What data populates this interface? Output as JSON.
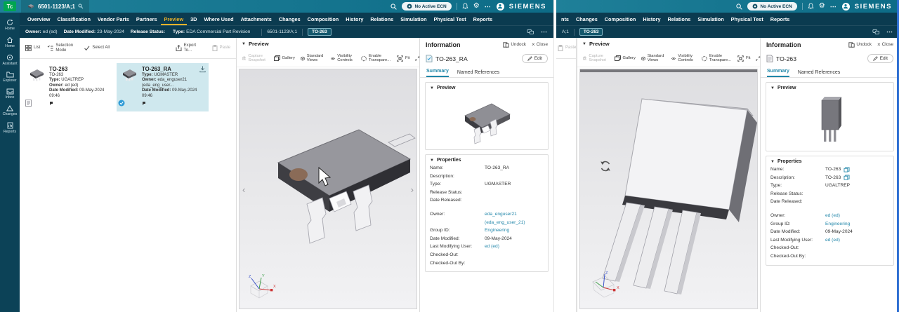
{
  "brand": {
    "siemens": "SIEMENS",
    "tc": "Tc"
  },
  "topbar": {
    "ecn": "No Active ECN"
  },
  "colors": {
    "topbar_teal": "#15708c",
    "nav_navy": "#0b3b50",
    "accent_yellow": "#f0b429",
    "link_teal": "#2387aa",
    "selected_card_bg": "#cfe8ee",
    "tc_green": "#00a550",
    "right_edge_blue": "#2e6fd2",
    "viewport_gray": "#e4e4e6"
  },
  "sidebar": {
    "items": [
      {
        "label": "Home"
      },
      {
        "label": "Home"
      },
      {
        "label": "Assistant"
      },
      {
        "label": "Explorer"
      },
      {
        "label": "Inbox"
      },
      {
        "label": "Changes"
      },
      {
        "label": "Reports"
      }
    ]
  },
  "left": {
    "doc_tab": "6501-1123/A;1",
    "nav": [
      "Overview",
      "Classification",
      "Vendor Parts",
      "Partners",
      "Preview",
      "3D",
      "Where Used",
      "Attachments",
      "Changes",
      "Composition",
      "History",
      "Relations",
      "Simulation",
      "Physical Test",
      "Reports"
    ],
    "crumb": {
      "owner_l": "Owner:",
      "owner": "ed (ed)",
      "mod_l": "Date Modified:",
      "mod": "23-May-2024",
      "rel_l": "Release Status:",
      "type_l": "Type:",
      "type": "EDA Commercial Part Revision",
      "id": "6501-1123/A;1",
      "chip": "TO-263"
    },
    "toolbar": {
      "list": "List",
      "selection_mode": "Selection Mode",
      "select_all": "Select All",
      "export_to": "Export To...",
      "paste": "Paste"
    },
    "cards": [
      {
        "title": "TO-263",
        "desc": "TO-263",
        "type_l": "Type:",
        "type": "UGALTREP",
        "owner_l": "Owner:",
        "owner": "ed (ed)",
        "mod_l": "Date Modified:",
        "mod": "09-May-2024 09:46"
      },
      {
        "title": "TO-263_RA",
        "type_l": "Type:",
        "type": "UGMASTER",
        "owner_l": "Owner:",
        "owner": "eda_enguser21 (eda_eng_user...",
        "mod_l": "Date Modified:",
        "mod": "09-May-2024 09:46"
      }
    ],
    "preview": {
      "title": "Preview",
      "tools": [
        "Capture Snapshot",
        "Gallery",
        "Standard Views",
        "Visibility Controls",
        "Enable Transpare...",
        "Fit",
        "Full Screen"
      ]
    },
    "info": {
      "title": "Information",
      "undock": "Undock",
      "close": "Close",
      "item": "TO-263_RA",
      "edit": "Edit",
      "tabs": [
        "Summary",
        "Named References"
      ],
      "preview_sec": "Preview",
      "props_sec": "Properties",
      "props": [
        {
          "l": "Name:",
          "v": "TO-263_RA"
        },
        {
          "l": "Description:",
          "v": ""
        },
        {
          "l": "Type:",
          "v": "UGMASTER"
        },
        {
          "l": "Release Status:",
          "v": ""
        },
        {
          "l": "Date Released:",
          "v": ""
        },
        {
          "l": "Owner:",
          "v": "eda_enguser21 (eda_eng_user_21)"
        },
        {
          "l": "Group ID:",
          "v": "Engineering"
        },
        {
          "l": "Date Modified:",
          "v": "09-May-2024"
        },
        {
          "l": "Last Modifying User:",
          "v": "ed (ed)"
        },
        {
          "l": "Checked-Out:",
          "v": ""
        },
        {
          "l": "Checked-Out By:",
          "v": ""
        }
      ]
    }
  },
  "right": {
    "nav_visible": [
      "nts",
      "Changes",
      "Composition",
      "History",
      "Relations",
      "Simulation",
      "Physical Test",
      "Reports"
    ],
    "crumb": {
      "id_frag": "A;1",
      "chip": "TO-263"
    },
    "paste": "Paste",
    "preview": {
      "title": "Preview",
      "tools": [
        "Capture Snapshot",
        "Gallery",
        "Standard Views",
        "Visibility Controls",
        "Enable Transpare...",
        "Fit",
        "Full Screen"
      ]
    },
    "info": {
      "title": "Information",
      "undock": "Undock",
      "close": "Close",
      "item": "TO-263",
      "edit": "Edit",
      "tabs": [
        "Summary",
        "Named References"
      ],
      "preview_sec": "Preview",
      "props_sec": "Properties",
      "props": [
        {
          "l": "Name:",
          "v": "TO-263"
        },
        {
          "l": "Description:",
          "v": "TO-263"
        },
        {
          "l": "Type:",
          "v": "UGALTREP"
        },
        {
          "l": "Release Status:",
          "v": ""
        },
        {
          "l": "Date Released:",
          "v": ""
        },
        {
          "l": "Owner:",
          "v": "ed (ed)"
        },
        {
          "l": "Group ID:",
          "v": "Engineering"
        },
        {
          "l": "Date Modified:",
          "v": "09-May-2024"
        },
        {
          "l": "Last Modifying User:",
          "v": "ed (ed)"
        },
        {
          "l": "Checked-Out:",
          "v": ""
        },
        {
          "l": "Checked-Out By:",
          "v": ""
        }
      ]
    }
  }
}
